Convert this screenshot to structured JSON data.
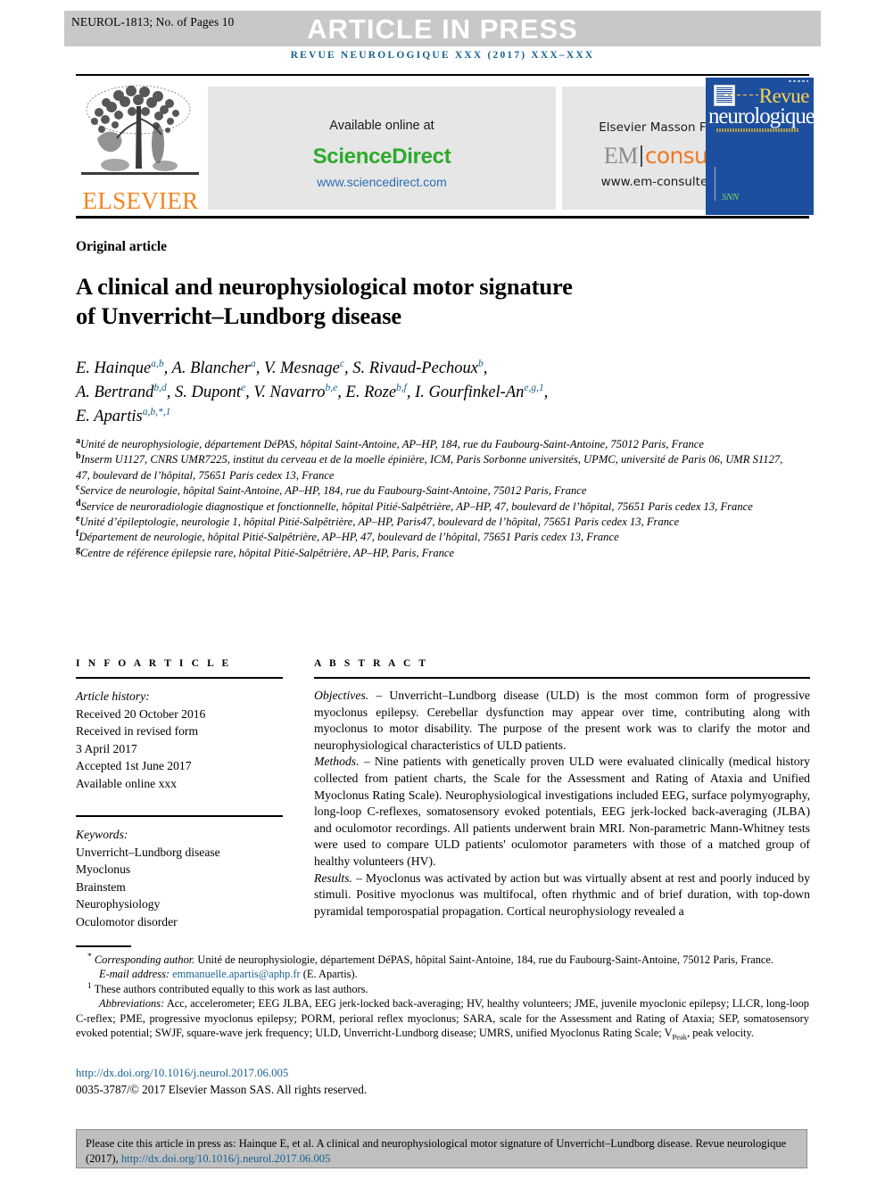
{
  "header": {
    "article_id": "NEUROL-1813; No. of Pages 10",
    "banner_text": "ARTICLE IN PRESS",
    "journal_line": "REVUE NEUROLOGIQUE XXX (2017) XXX–XXX",
    "banner_bg": "#c8c8c8",
    "journal_color": "#18618f"
  },
  "publisher": {
    "elsevier_wordmark": "ELSEVIER",
    "elsevier_color": "#f28520",
    "available_online": "Available online at",
    "sciencedirect": "ScienceDirect",
    "sciencedirect_color": "#2caa2c",
    "sciencedirect_url": "www.sciencedirect.com",
    "masson": "Elsevier Masson France",
    "em_prefix": "EM",
    "em_suffix": "consulte",
    "em_color": "#f07820",
    "em_url": "www.em-consulte.com",
    "cover": {
      "line1": "Revue",
      "line2": "neurologique",
      "bg": "#1d4f9e",
      "title_color": "#ffd34d"
    }
  },
  "article": {
    "kind": "Original article",
    "title_line1": "A clinical and neurophysiological motor signature",
    "title_line2": "of Unverricht–Lundborg disease"
  },
  "authors": [
    {
      "name": "E. Hainque",
      "sup": "a,b",
      "sep": ", "
    },
    {
      "name": "A. Blancher",
      "sup": "a",
      "sep": ", "
    },
    {
      "name": "V. Mesnage",
      "sup": "c",
      "sep": ", "
    },
    {
      "name": "S. Rivaud-Pechoux",
      "sup": "b",
      "sep": ","
    },
    {
      "name": "A. Bertrand",
      "sup": "b,d",
      "sep": ", "
    },
    {
      "name": "S. Dupont",
      "sup": "e",
      "sep": ", "
    },
    {
      "name": "V. Navarro",
      "sup": "b,e",
      "sep": ", "
    },
    {
      "name": "E. Roze",
      "sup": "b,f",
      "sep": ", "
    },
    {
      "name": "I. Gourfinkel-An",
      "sup": "e,g,1",
      "sep": ","
    },
    {
      "name": "E. Apartis",
      "sup": "a,b,*,1",
      "sep": ""
    }
  ],
  "affiliations": [
    {
      "marker": "a",
      "text": "Unité de neurophysiologie, département DéPAS, hôpital Saint-Antoine, AP–HP, 184, rue du Faubourg-Saint-Antoine, 75012 Paris, France"
    },
    {
      "marker": "b",
      "text": "Inserm U1127, CNRS UMR7225, institut du cerveau et de la moelle épinière, ICM, Paris Sorbonne universités, UPMC, université de Paris 06, UMR S1127, 47, boulevard de l’hôpital, 75651 Paris cedex 13, France"
    },
    {
      "marker": "c",
      "text": "Service de neurologie, hôpital Saint-Antoine, AP–HP, 184, rue du Faubourg-Saint-Antoine, 75012 Paris, France"
    },
    {
      "marker": "d",
      "text": "Service de neuroradiologie diagnostique et fonctionnelle, hôpital Pitié-Salpêtrière, AP–HP, 47, boulevard de l’hôpital, 75651 Paris cedex 13, France"
    },
    {
      "marker": "e",
      "text": "Unité d’épileptologie, neurologie 1, hôpital Pitié-Salpêtrière, AP–HP, Paris47, boulevard de l’hôpital, 75651 Paris cedex 13, France"
    },
    {
      "marker": "f",
      "text": "Département de neurologie, hôpital Pitié-Salpêtrière, AP–HP, 47, boulevard de l’hôpital, 75651 Paris cedex 13, France"
    },
    {
      "marker": "g",
      "text": "Centre de référence épilepsie rare, hôpital Pitié-Salpêtrière, AP–HP, Paris, France"
    }
  ],
  "info": {
    "heading": "I N F O  A R T I C L E",
    "history_label": "Article history:",
    "history": [
      "Received 20 October 2016",
      "Received in revised form",
      "3 April 2017",
      "Accepted 1st June 2017",
      "Available online xxx"
    ],
    "keywords_label": "Keywords:",
    "keywords": [
      "Unverricht–Lundborg disease",
      "Myoclonus",
      "Brainstem",
      "Neurophysiology",
      "Oculomotor disorder"
    ]
  },
  "abstract": {
    "heading": "A B S T R A C T",
    "sections": [
      {
        "label": "Objectives.",
        "dash": " – ",
        "text": "Unverricht–Lundborg disease (ULD) is the most common form of progressive myoclonus epilepsy. Cerebellar dysfunction may appear over time, contributing along with myoclonus to motor disability. The purpose of the present work was to clarify the motor and neurophysiological characteristics of ULD patients."
      },
      {
        "label": "Methods.",
        "dash": " – ",
        "text": "Nine patients with genetically proven ULD were evaluated clinically (medical history collected from patient charts, the Scale for the Assessment and Rating of Ataxia and Unified Myoclonus Rating Scale). Neurophysiological investigations included EEG, surface polymyography, long-loop C-reflexes, somatosensory evoked potentials, EEG jerk-locked back-averaging (JLBA) and oculomotor recordings. All patients underwent brain MRI. Non-parametric Mann-Whitney tests were used to compare ULD patients' oculomotor parameters with those of a matched group of healthy volunteers (HV)."
      },
      {
        "label": "Results.",
        "dash": " – ",
        "text": "Myoclonus was activated by action but was virtually absent at rest and poorly induced by stimuli. Positive myoclonus was multifocal, often rhythmic and of brief duration, with top-down pyramidal temporospatial propagation. Cortical neurophysiology revealed a"
      }
    ]
  },
  "footnotes": {
    "corresponding_marker": "*",
    "corresponding_label": "Corresponding author.",
    "corresponding_text": " Unité de neurophysiologie, département DéPAS, hôpital Saint-Antoine, 184, rue du Faubourg-Saint-Antoine, 75012 Paris, France.",
    "email_label": "E-mail address:",
    "email": "emmanuelle.apartis@aphp.fr",
    "email_suffix": " (E. Apartis).",
    "equal_marker": "1",
    "equal_contrib": "These authors contributed equally to this work as last authors.",
    "abbrev_label": "Abbreviations:",
    "abbrev_text": " Acc, accelerometer; EEG JLBA, EEG jerk-locked back-averaging; HV, healthy volunteers; JME, juvenile myoclonic epilepsy; LLCR, long-loop C-reflex; PME, progressive myoclonus epilepsy; PORM, perioral reflex myoclonus; SARA, scale for the Assessment and Rating of Ataxia; SEP, somatosensory evoked potential; SWJF, square-wave jerk frequency; ULD, Unverricht-Lundborg disease; UMRS, unified Myoclonus Rating Scale; V",
    "abbrev_sub": "Peak",
    "abbrev_tail": ", peak velocity.",
    "doi": "http://dx.doi.org/10.1016/j.neurol.2017.06.005",
    "copyright": "0035-3787/© 2017 Elsevier Masson SAS. All rights reserved."
  },
  "citation": {
    "text_before": "Please cite this article in press as: Hainque E, et al. A clinical and neurophysiological motor signature of Unverricht–Lundborg disease. Revue neurologique (2017), ",
    "link": "http://dx.doi.org/10.1016/j.neurol.2017.06.005",
    "bg": "#bfbfbf"
  }
}
